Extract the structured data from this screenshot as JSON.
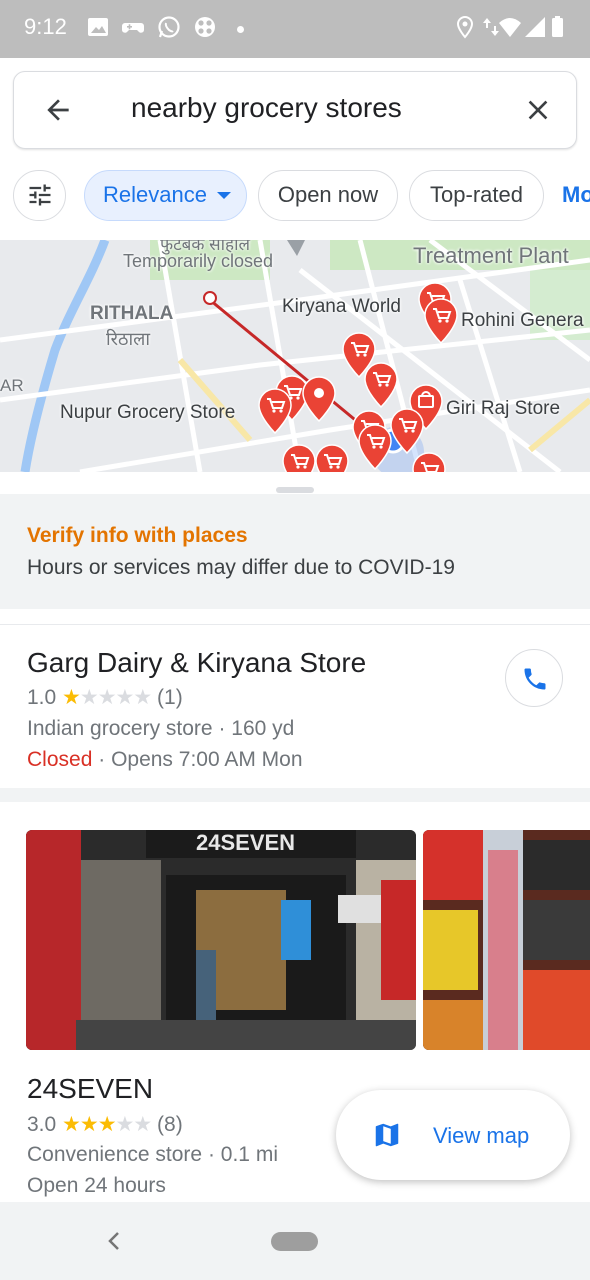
{
  "status_bar": {
    "time": "9:12",
    "icons": [
      "image-icon",
      "game-controller-icon",
      "whatsapp-icon",
      "settings-shortcut-icon",
      "notification-dot",
      "location-icon",
      "data-transfer-icon",
      "wifi-icon",
      "signal-icon",
      "battery-icon"
    ]
  },
  "search": {
    "query": "nearby grocery stores",
    "back_icon": "arrow-back-icon",
    "clear_icon": "close-icon"
  },
  "filters": {
    "options_icon": "tune-icon",
    "chips": [
      {
        "label": "Relevance",
        "selected": true
      },
      {
        "label": "Open now",
        "selected": false
      },
      {
        "label": "Top-rated",
        "selected": false
      }
    ],
    "more_label": "Mo"
  },
  "map": {
    "labels": {
      "temporarily_closed": "Temporarily closed",
      "partial_top": "फुटबैक सोहाल",
      "treatment_plant": "Treatment Plant",
      "rithala": "RITHALA",
      "rithala_hindi": "रिठाला",
      "kiryana_world": "Kiryana World",
      "rohini_general": "Rohini Genera",
      "nupur": "Nupur Grocery Store",
      "giri_raj": "Giri Raj Store",
      "ar_partial": "AR"
    },
    "pin_color": "#ea4335",
    "location_color": "#4285f4"
  },
  "notice": {
    "title": "Verify info with places",
    "text": "Hours or services may differ due to COVID-19",
    "title_color": "#e37400"
  },
  "results": [
    {
      "name": "Garg Dairy & Kiryana Store",
      "rating": "1.0",
      "stars": 1,
      "reviews": "(1)",
      "category": "Indian grocery store",
      "distance": "160 yd",
      "status": "Closed",
      "hours": "Opens 7:00 AM Mon",
      "call_icon": "phone-icon"
    },
    {
      "name": "24SEVEN",
      "rating": "3.0",
      "stars": 3,
      "reviews": "(8)",
      "category": "Convenience store",
      "distance": "0.1 mi",
      "hours": "Open 24 hours",
      "photos": [
        "storefront-photo",
        "snacks-shelf-photo"
      ],
      "storefront_sign": "24SEVEN"
    }
  ],
  "view_map": {
    "label": "View map",
    "icon": "map-icon"
  },
  "nav_bar": {
    "back_icon": "nav-back-icon",
    "home_icon": "nav-home-pill"
  },
  "separator": "·"
}
